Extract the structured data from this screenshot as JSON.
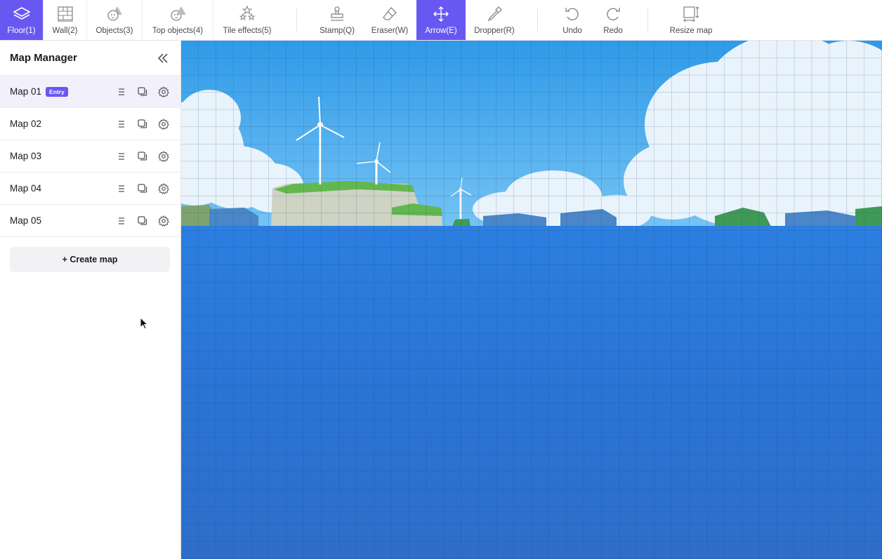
{
  "toolbar": {
    "tools": [
      {
        "label": "Floor(1)",
        "icon": "layers-icon",
        "active": true
      },
      {
        "label": "Wall(2)",
        "icon": "brick-wall-icon",
        "active": false
      },
      {
        "label": "Objects(3)",
        "icon": "objects-icon",
        "active": false
      },
      {
        "label": "Top objects(4)",
        "icon": "top-objects-icon",
        "active": false
      },
      {
        "label": "Tile effects(5)",
        "icon": "sparkle-stars-icon",
        "active": false
      }
    ],
    "actions": [
      {
        "label": "Stamp(Q)",
        "icon": "stamp-icon"
      },
      {
        "label": "Eraser(W)",
        "icon": "eraser-icon"
      },
      {
        "label": "Arrow(E)",
        "icon": "move-arrows-icon",
        "active": true
      },
      {
        "label": "Dropper(R)",
        "icon": "dropper-icon"
      }
    ],
    "history": [
      {
        "label": "Undo",
        "icon": "undo-icon"
      },
      {
        "label": "Redo",
        "icon": "redo-icon"
      }
    ],
    "resize_label": "Resize map",
    "accent_color": "#6758f2"
  },
  "sidebar": {
    "title": "Map Manager",
    "maps": [
      {
        "name": "Map 01",
        "badge": "Entry",
        "selected": true
      },
      {
        "name": "Map 02"
      },
      {
        "name": "Map 03"
      },
      {
        "name": "Map 04"
      },
      {
        "name": "Map 05"
      }
    ],
    "create_label": "+ Create map"
  },
  "canvas": {
    "background": "ocean-landscape-with-wind-turbines",
    "grid": true
  }
}
